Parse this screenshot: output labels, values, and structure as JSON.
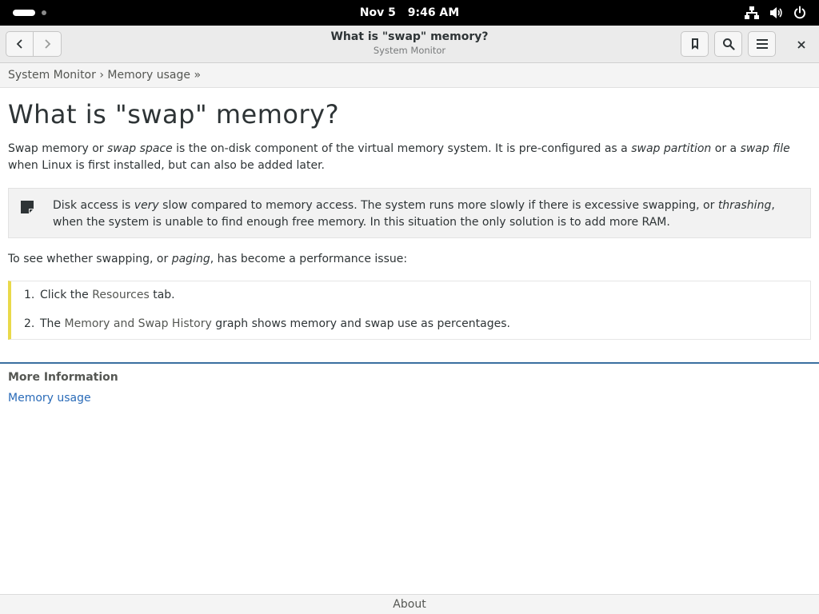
{
  "topbar": {
    "date": "Nov 5",
    "time": "9:46 AM",
    "icons": [
      "network-icon",
      "volume-icon",
      "power-icon"
    ]
  },
  "header": {
    "title": "What is \"swap\" memory?",
    "subtitle": "System Monitor",
    "icons": [
      "back-icon",
      "forward-icon",
      "bookmark-icon",
      "search-icon",
      "menu-icon",
      "close-icon"
    ]
  },
  "breadcrumb": {
    "item1": "System Monitor",
    "sep": " › ",
    "item2": "Memory usage",
    "trail": " »"
  },
  "content": {
    "title": "What is \"swap\" memory?",
    "intro": {
      "t1": "Swap memory or ",
      "e1": "swap space",
      "t2": " is the on-disk component of the virtual memory system. It is pre-configured as a ",
      "e2": "swap partition",
      "t3": " or a ",
      "e3": "swap file",
      "t4": " when Linux is first installed, but can also be added later."
    },
    "note": {
      "t1": "Disk access is ",
      "e1": "very",
      "t2": " slow compared to memory access. The system runs more slowly if there is excessive swapping, or ",
      "e2": "thrashing",
      "t3": ", when the system is unable to find enough free memory. In this situation the only solution is to add more RAM."
    },
    "check": {
      "t1": "To see whether swapping, or ",
      "e1": "paging",
      "t2": ", has become a performance issue:"
    },
    "steps": [
      {
        "num": "1.",
        "t1": "Click the ",
        "gui": "Resources",
        "t2": " tab."
      },
      {
        "num": "2.",
        "t1": "The ",
        "gui": "Memory and Swap History",
        "t2": " graph shows memory and swap use as percentages."
      }
    ]
  },
  "more_info": {
    "title": "More Information",
    "link": "Memory usage"
  },
  "footer": {
    "about": "About"
  }
}
